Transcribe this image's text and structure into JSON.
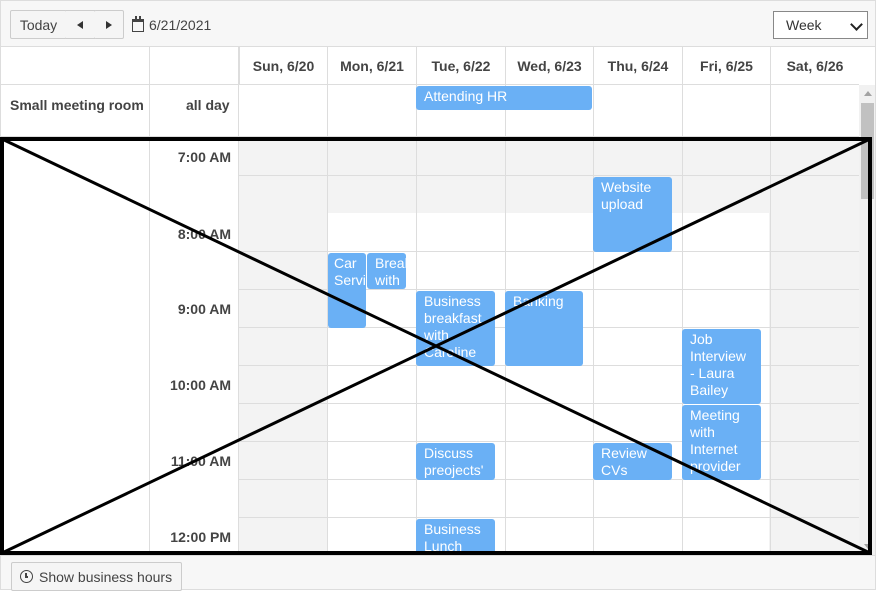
{
  "toolbar": {
    "today_label": "Today",
    "prev_icon": "triangle-left-icon",
    "next_icon": "triangle-right-icon",
    "date": "6/21/2021",
    "view": "Week"
  },
  "days": [
    "Sun, 6/20",
    "Mon, 6/21",
    "Tue, 6/22",
    "Wed, 6/23",
    "Thu, 6/24",
    "Fri, 6/25",
    "Sat, 6/26"
  ],
  "group_label": "Small meeting room",
  "allday_label": "all day",
  "times": [
    "7:00 AM",
    "8:00 AM",
    "9:00 AM",
    "10:00 AM",
    "11:00 AM",
    "12:00 PM"
  ],
  "events": {
    "attending_hr": "Attending HR",
    "website_upload": "Website upload",
    "car_service": "Car Service",
    "breakfast_with": "Breakfast with",
    "business_breakfast": "Business breakfast with Caroline",
    "banking": "Banking",
    "job_interview": "Job Interview - Laura Bailey",
    "meeting_internet": "Meeting with Internet provider",
    "discuss_projects": "Discuss preojects'",
    "review_cvs": "Review CVs",
    "business_lunch": "Business Lunch"
  },
  "footer": {
    "business_hours_label": "Show business hours"
  },
  "colors": {
    "event": "#6ab0f5",
    "offhours": "#f3f3f3",
    "border": "#dddddd"
  }
}
